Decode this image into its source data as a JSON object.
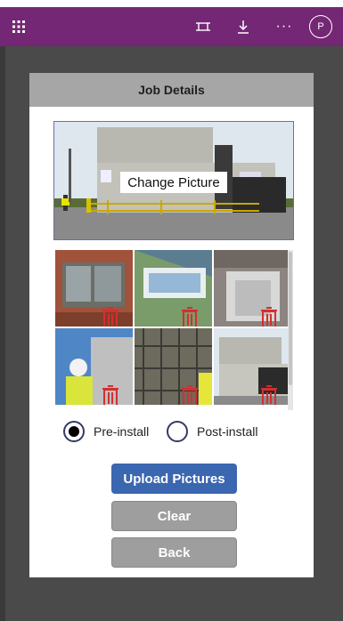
{
  "app": {
    "avatar_initial": "P"
  },
  "card": {
    "title": "Job Details",
    "change_picture_label": "Change Picture",
    "radio_options": [
      {
        "label": "Pre-install",
        "selected": true
      },
      {
        "label": "Post-install",
        "selected": false
      }
    ],
    "buttons": {
      "upload": "Upload Pictures",
      "clear": "Clear",
      "back": "Back"
    }
  },
  "colors": {
    "topbar": "#742774",
    "upload_button": "#3b66b0",
    "secondary_button": "#9e9e9e",
    "trash_icon": "#d32f2f"
  },
  "icons": [
    "app-launcher-icon",
    "fit-to-screen-icon",
    "download-icon",
    "more-icon",
    "trash-icon"
  ]
}
